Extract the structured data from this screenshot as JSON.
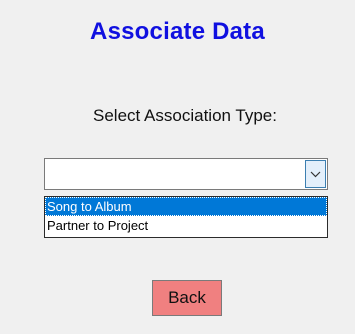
{
  "title": "Associate Data",
  "prompt": "Select Association Type:",
  "association_combo": {
    "value": "",
    "open": true,
    "options": [
      "Song to Album",
      "Partner to Project"
    ],
    "highlighted_option": "Song to Album",
    "dropdown_icon": "chevron-down-icon"
  },
  "back_button": {
    "label": "Back",
    "color": "#f08080"
  },
  "colors": {
    "title": "#1010e0",
    "background": "#f0f0f0",
    "highlight": "#0078d7"
  }
}
